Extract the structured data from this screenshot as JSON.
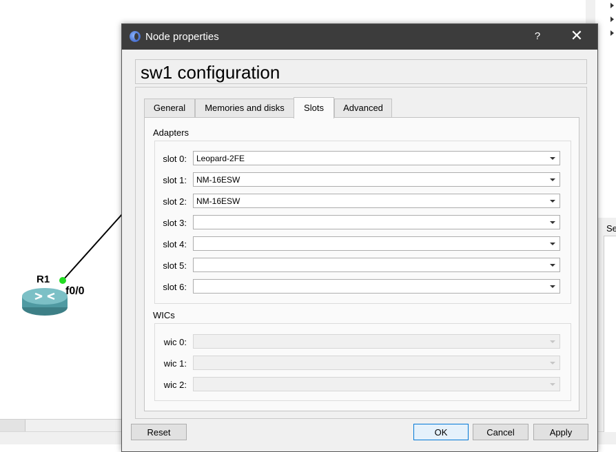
{
  "canvas": {
    "node_label": "R1",
    "port_label": "f0/0"
  },
  "right_dock": {
    "section_label": "Se"
  },
  "dialog": {
    "title": "Node properties",
    "help_label": "?",
    "close_label": "✕",
    "heading": "sw1 configuration",
    "tabs": [
      {
        "label": "General",
        "active": false
      },
      {
        "label": "Memories and disks",
        "active": false
      },
      {
        "label": "Slots",
        "active": true
      },
      {
        "label": "Advanced",
        "active": false
      }
    ],
    "adapters": {
      "title": "Adapters",
      "slots": [
        {
          "label": "slot 0:",
          "value": "Leopard-2FE"
        },
        {
          "label": "slot 1:",
          "value": "NM-16ESW"
        },
        {
          "label": "slot 2:",
          "value": "NM-16ESW"
        },
        {
          "label": "slot 3:",
          "value": ""
        },
        {
          "label": "slot 4:",
          "value": ""
        },
        {
          "label": "slot 5:",
          "value": ""
        },
        {
          "label": "slot 6:",
          "value": ""
        }
      ]
    },
    "wics": {
      "title": "WICs",
      "slots": [
        {
          "label": "wic 0:",
          "value": ""
        },
        {
          "label": "wic 1:",
          "value": ""
        },
        {
          "label": "wic 2:",
          "value": ""
        }
      ]
    },
    "buttons": {
      "reset": "Reset",
      "ok": "OK",
      "cancel": "Cancel",
      "apply": "Apply"
    }
  },
  "colors": {
    "titlebar": "#3c3c3c",
    "port_status": "#22dd22",
    "default_button_border": "#0078d7"
  }
}
